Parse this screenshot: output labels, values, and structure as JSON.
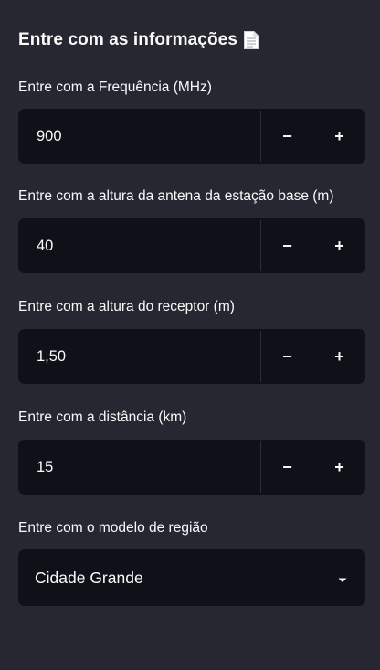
{
  "sidebar": {
    "heading": "Entre com as informações",
    "heading_icon": "page-facing-up-icon",
    "fields": [
      {
        "label": "Entre com a Frequência (MHz)",
        "value": "900",
        "decrement_label": "−",
        "increment_label": "+"
      },
      {
        "label": "Entre com a altura da antena da estação base (m)",
        "value": "40",
        "decrement_label": "−",
        "increment_label": "+"
      },
      {
        "label": "Entre com a altura do receptor (m)",
        "value": "1,50",
        "decrement_label": "−",
        "increment_label": "+"
      },
      {
        "label": "Entre com a distância (km)",
        "value": "15",
        "decrement_label": "−",
        "increment_label": "+"
      }
    ],
    "region": {
      "label": "Entre com o modelo de região",
      "selected": "Cidade Grande"
    }
  },
  "colors": {
    "background": "#262730",
    "input_background": "#0e1117",
    "text": "#fafafa"
  }
}
